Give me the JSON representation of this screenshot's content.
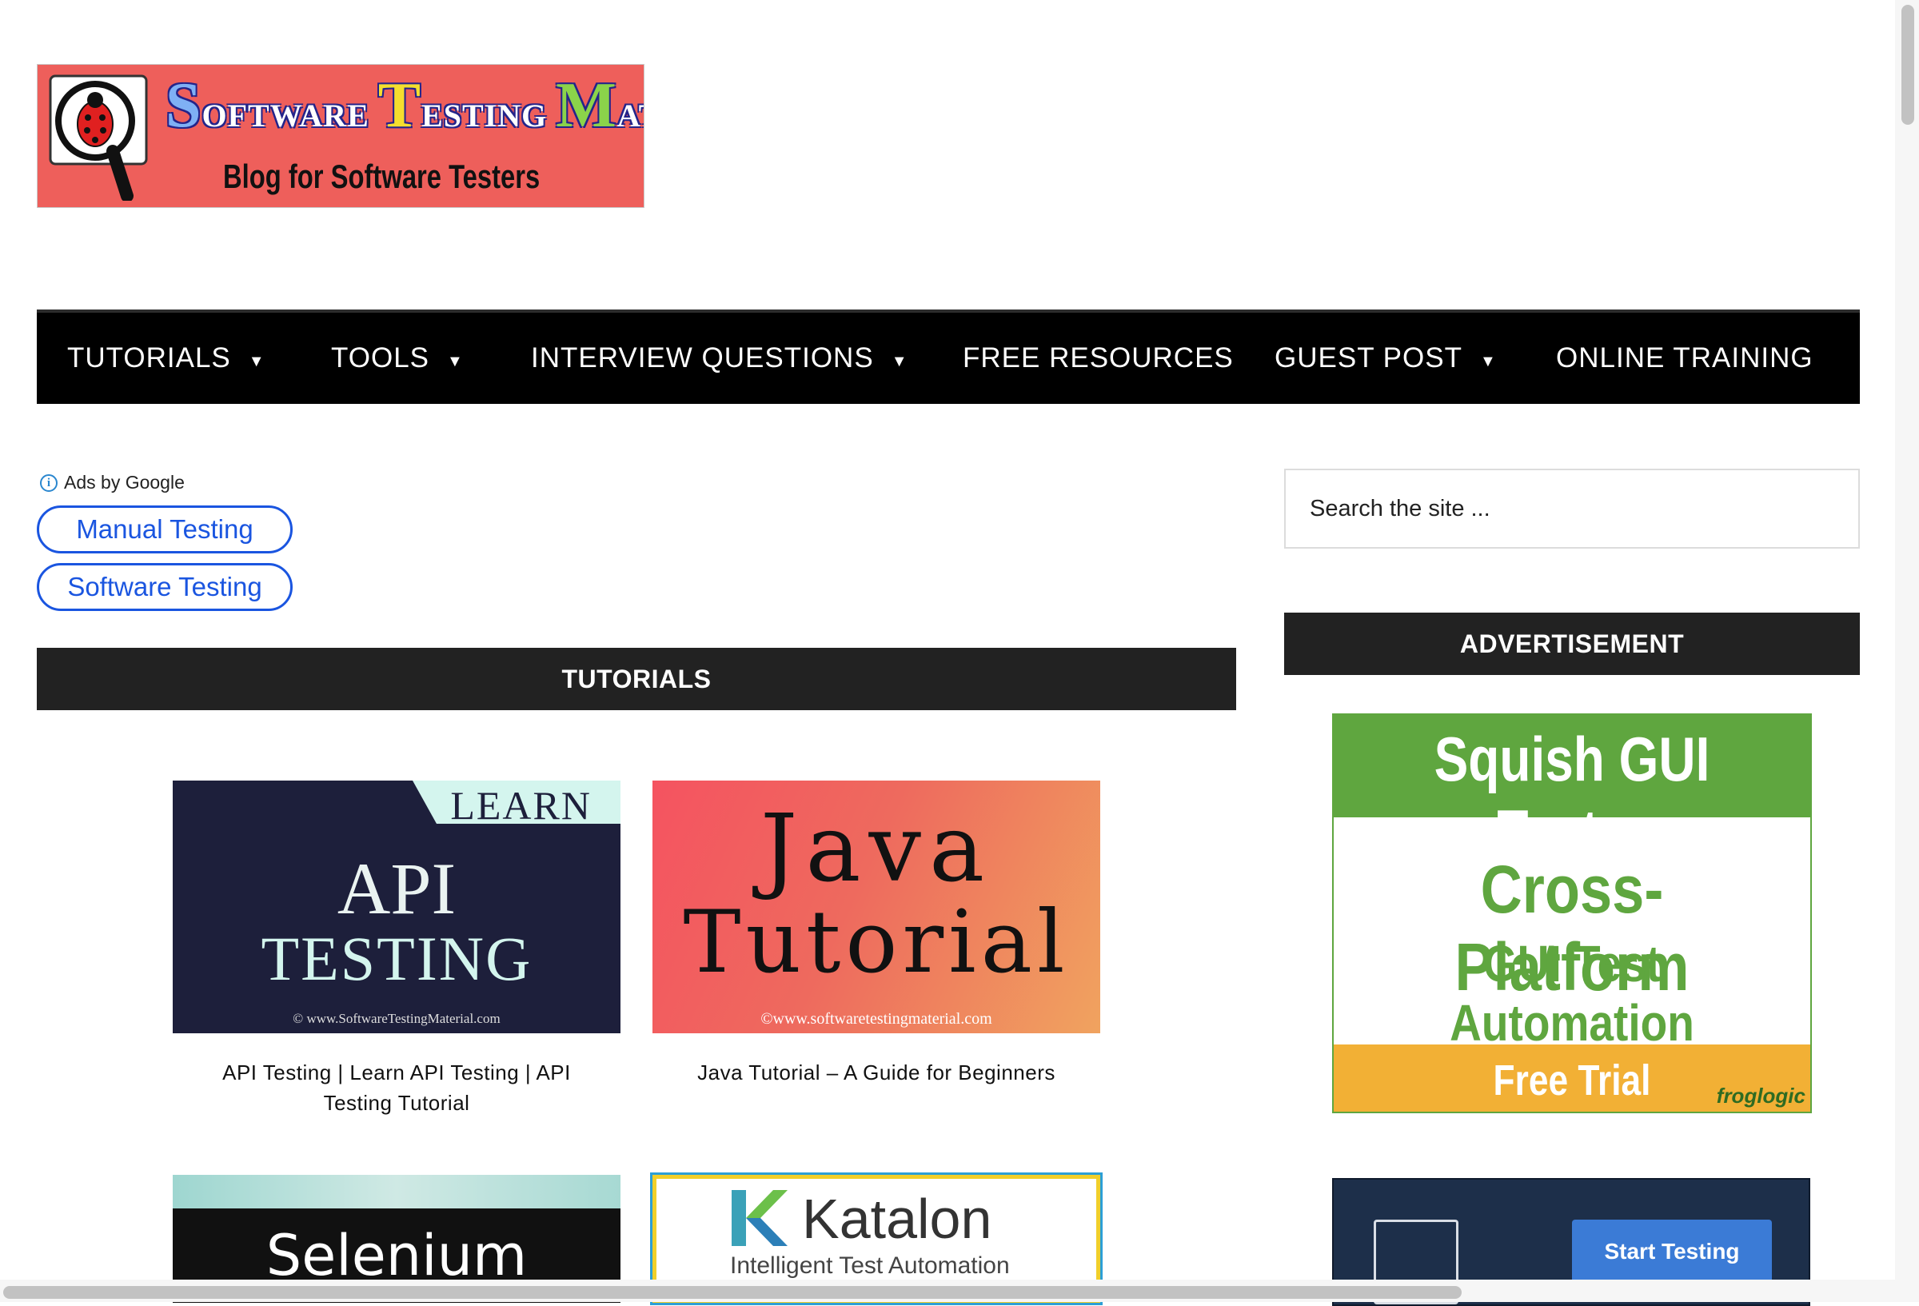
{
  "logo": {
    "title_parts": [
      {
        "cap": "S",
        "rest": "OFTWARE"
      },
      {
        "cap": "T",
        "rest": "ESTING"
      },
      {
        "cap": "M",
        "rest": "ATERIAL"
      }
    ],
    "tagline": "Blog for Software Testers"
  },
  "nav": {
    "items": [
      {
        "label": "TUTORIALS",
        "dropdown": "▼"
      },
      {
        "label": "TOOLS",
        "dropdown": "▼"
      },
      {
        "label": "INTERVIEW QUESTIONS",
        "dropdown": "▼"
      },
      {
        "label": "FREE RESOURCES"
      },
      {
        "label": "GUEST POST",
        "dropdown": "▼"
      },
      {
        "label": "ONLINE TRAINING"
      }
    ]
  },
  "ads": {
    "label": "Ads by Google",
    "info_glyph": "i",
    "links": [
      "Manual Testing",
      "Software Testing"
    ]
  },
  "tutorials": {
    "heading": "TUTORIALS",
    "cards": [
      {
        "image": {
          "badge": "LEARN",
          "line1": "API",
          "line2": "TESTING",
          "watermark": "© www.SoftwareTestingMaterial.com"
        },
        "caption": "API Testing | Learn API Testing | API Testing Tutorial"
      },
      {
        "image": {
          "line1": "Java",
          "line2": "Tutorial",
          "watermark": "©www.softwaretestingmaterial.com"
        },
        "caption": "Java Tutorial – A Guide for Beginners"
      },
      {
        "image": {
          "text": "Selenium"
        }
      },
      {
        "image": {
          "name": "Katalon",
          "tagline": "Intelligent Test Automation"
        }
      }
    ]
  },
  "sidebar": {
    "search_placeholder": "Search the site ...",
    "ad_heading": "ADVERTISEMENT",
    "squish_ad": {
      "title": "Squish GUI Tester",
      "headline": "Cross-Platform",
      "subheadline": "GUI Test Automation",
      "cta": "Free Trial",
      "brand": "froglogic"
    },
    "second_ad": {
      "cta": "Start Testing"
    }
  },
  "colors": {
    "nav_bg": "#000000",
    "section_bar_bg": "#222222",
    "ad_link": "#1a55e0",
    "logo_bg": "#ee5f5b",
    "squish_green": "#5fa63f",
    "squish_orange": "#f2b035"
  }
}
